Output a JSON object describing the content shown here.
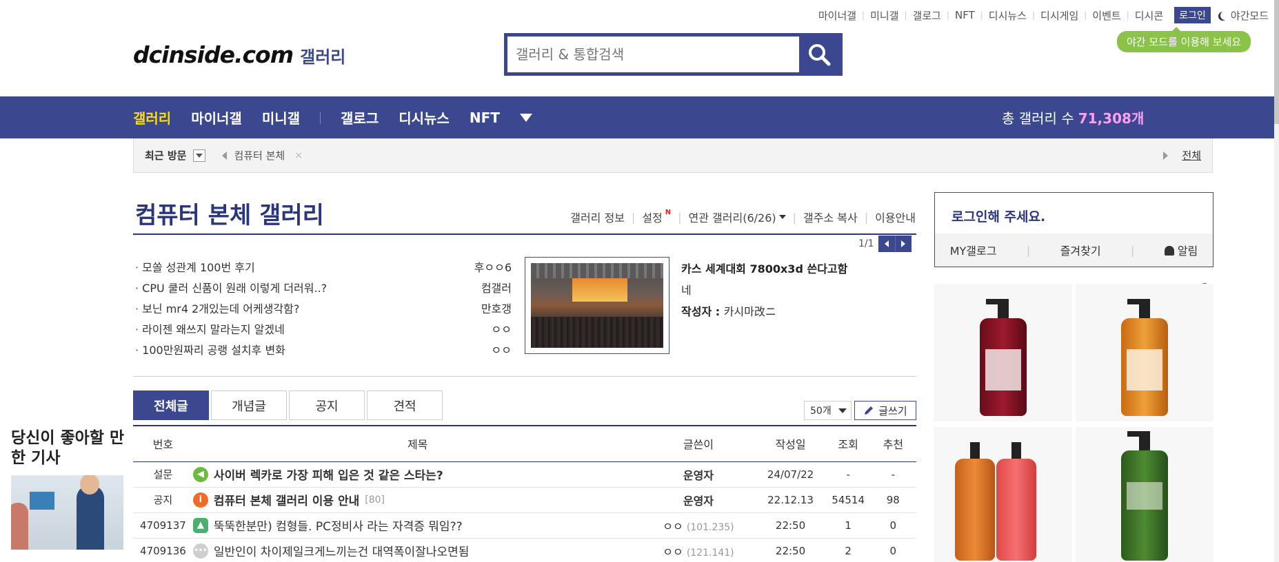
{
  "top_util": {
    "links": [
      "마이너갤",
      "미니갤",
      "갤로그",
      "NFT",
      "디시뉴스",
      "디시게임",
      "이벤트",
      "디시콘"
    ],
    "login": "로그인",
    "night_mode": "야간모드",
    "night_tip": "야간 모드를 이용해 보세요"
  },
  "logo": {
    "main": "dcinside.com",
    "sub": "갤러리"
  },
  "search": {
    "placeholder": "갤러리 & 통합검색"
  },
  "nav": {
    "items": [
      "갤러리",
      "마이너갤",
      "미니갤",
      "갤로그",
      "디시뉴스",
      "NFT"
    ],
    "total_label": "총 갤러리 수",
    "total_count": "71,308개"
  },
  "recent": {
    "label": "최근 방문",
    "item": "컴퓨터 본체",
    "close": "×",
    "all": "전체"
  },
  "gallery": {
    "title": "컴퓨터 본체 갤러리",
    "menu": [
      "갤러리 정보",
      "설정",
      "연관 갤러리(6/26)",
      "갤주소 복사",
      "이용안내"
    ],
    "new_mark": "N",
    "pager": "1/1"
  },
  "concept_posts": [
    {
      "title": "모쏠 성관계 100번 후기",
      "author": "후ㅇㅇ6"
    },
    {
      "title": "CPU 쿨러 신품이 원래 이렇게 더러워..?",
      "author": "컴갤러"
    },
    {
      "title": "보닌 mr4 2개있는데 어케생각함?",
      "author": "만호갱"
    },
    {
      "title": "라이젠 왜쓰지 말라는지 알겠네",
      "author": "ㅇㅇ"
    },
    {
      "title": "100만원짜리 공랭 설치후 변화",
      "author": "ㅇㅇ"
    }
  ],
  "feature": {
    "title_line1": "카스 세계대회 7800x3d 쓴다고함",
    "title_line2": "네",
    "author_label": "작성자 : ",
    "author": "카시마改ニ"
  },
  "tabs": [
    "전체글",
    "개념글",
    "공지",
    "견적"
  ],
  "list_size": "50개",
  "write_btn": "글쓰기",
  "table": {
    "headers": [
      "번호",
      "제목",
      "글쓴이",
      "작성일",
      "조회",
      "추천"
    ],
    "rows": [
      {
        "no": "설문",
        "icon": "survey",
        "subject": "사이버 렉카로 가장 피해 입은 것 같은 스타는?",
        "comments": "",
        "writer": "운영자",
        "ip": "",
        "date": "24/07/22",
        "views": "-",
        "recs": "-"
      },
      {
        "no": "공지",
        "icon": "info",
        "subject": "컴퓨터 본체 갤러리 이용 안내",
        "comments": "[80]",
        "writer": "운영자",
        "ip": "",
        "date": "22.12.13",
        "views": "54514",
        "recs": "98"
      },
      {
        "no": "4709137",
        "icon": "image",
        "subject": "뚝뚝한분만) 컴형들. PC정비사 라는 자격증 뭐임??",
        "comments": "",
        "writer": "ㅇㅇ",
        "ip": "(101.235)",
        "date": "22:50",
        "views": "1",
        "recs": "0"
      },
      {
        "no": "4709136",
        "icon": "text",
        "subject": "일반인이 차이제일크게느끼는건 대역폭이잘나오면됨",
        "comments": "",
        "writer": "ㅇㅇ",
        "ip": "(121.141)",
        "date": "22:50",
        "views": "2",
        "recs": "0"
      }
    ]
  },
  "login_box": {
    "title": "로그인해 주세요.",
    "links": [
      "MY갤로그",
      "즐겨찾기",
      "알림"
    ]
  },
  "article": {
    "title": "당신이 좋아할 만한 기사"
  },
  "colors": {
    "brand": "#3b4890",
    "brand_dark": "#29367c",
    "accent_yellow": "#ffde00",
    "night_tip": "#8bc34a"
  },
  "icons": [
    "search-icon",
    "moon-icon",
    "chevron-down-icon",
    "pencil-icon",
    "bell-icon",
    "info-icon"
  ]
}
